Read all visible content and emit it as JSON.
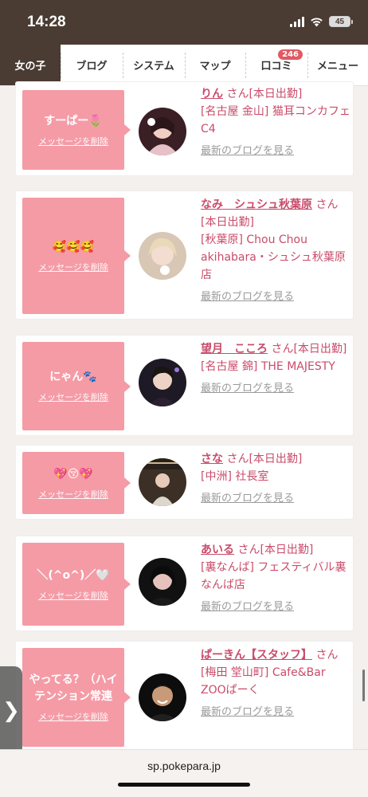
{
  "status": {
    "time": "14:28",
    "battery": "45"
  },
  "nav": {
    "items": [
      {
        "label": "女の子",
        "active": true
      },
      {
        "label": "ブログ"
      },
      {
        "label": "システム"
      },
      {
        "label": "マップ"
      },
      {
        "label": "口コミ",
        "badge": "246"
      },
      {
        "label": "メニュー"
      }
    ]
  },
  "cards": [
    {
      "message": "すーぱー🌷",
      "delete_label": "メッセージを削除",
      "name": "りん",
      "san_suffix": "さん[本日出勤]",
      "shop": "[名古屋 金山] 猫耳コンカフェ C4",
      "blog_link": "最新のブログを見る"
    },
    {
      "message": "🥰🥰🥰",
      "delete_label": "メッセージを削除",
      "name": "なみ　シュシュ秋葉原",
      "san_suffix": "さん[本日出勤]",
      "shop": "[秋葉原] Chou Chou akihabara・シュシュ秋葉原店",
      "blog_link": "最新のブログを見る"
    },
    {
      "message": "にゃん🐾",
      "delete_label": "メッセージを削除",
      "name": "望月　こころ",
      "san_suffix": "さん[本日出勤]",
      "shop": "[名古屋 錦] THE MAJESTY",
      "blog_link": "最新のブログを見る"
    },
    {
      "message": "💖😚💖",
      "delete_label": "メッセージを削除",
      "name": "さな",
      "san_suffix": "さん[本日出勤]",
      "shop": "[中洲] 社長室",
      "blog_link": "最新のブログを見る"
    },
    {
      "message": "＼(^o^)／🤍",
      "delete_label": "メッセージを削除",
      "name": "あいる",
      "san_suffix": "さん[本日出勤]",
      "shop": "[裏なんば] フェスティバル裏なんば店",
      "blog_link": "最新のブログを見る"
    },
    {
      "message": "やってる？（ハイテンション常連",
      "delete_label": "メッセージを削除",
      "name": "ぱーきん【スタッフ】",
      "san_suffix": "さん",
      "shop": "[梅田 堂山町] Cafe&Bar ZOOぱーく",
      "blog_link": "最新のブログを見る"
    }
  ],
  "side_handle": "❯",
  "url": "sp.pokepara.jp"
}
